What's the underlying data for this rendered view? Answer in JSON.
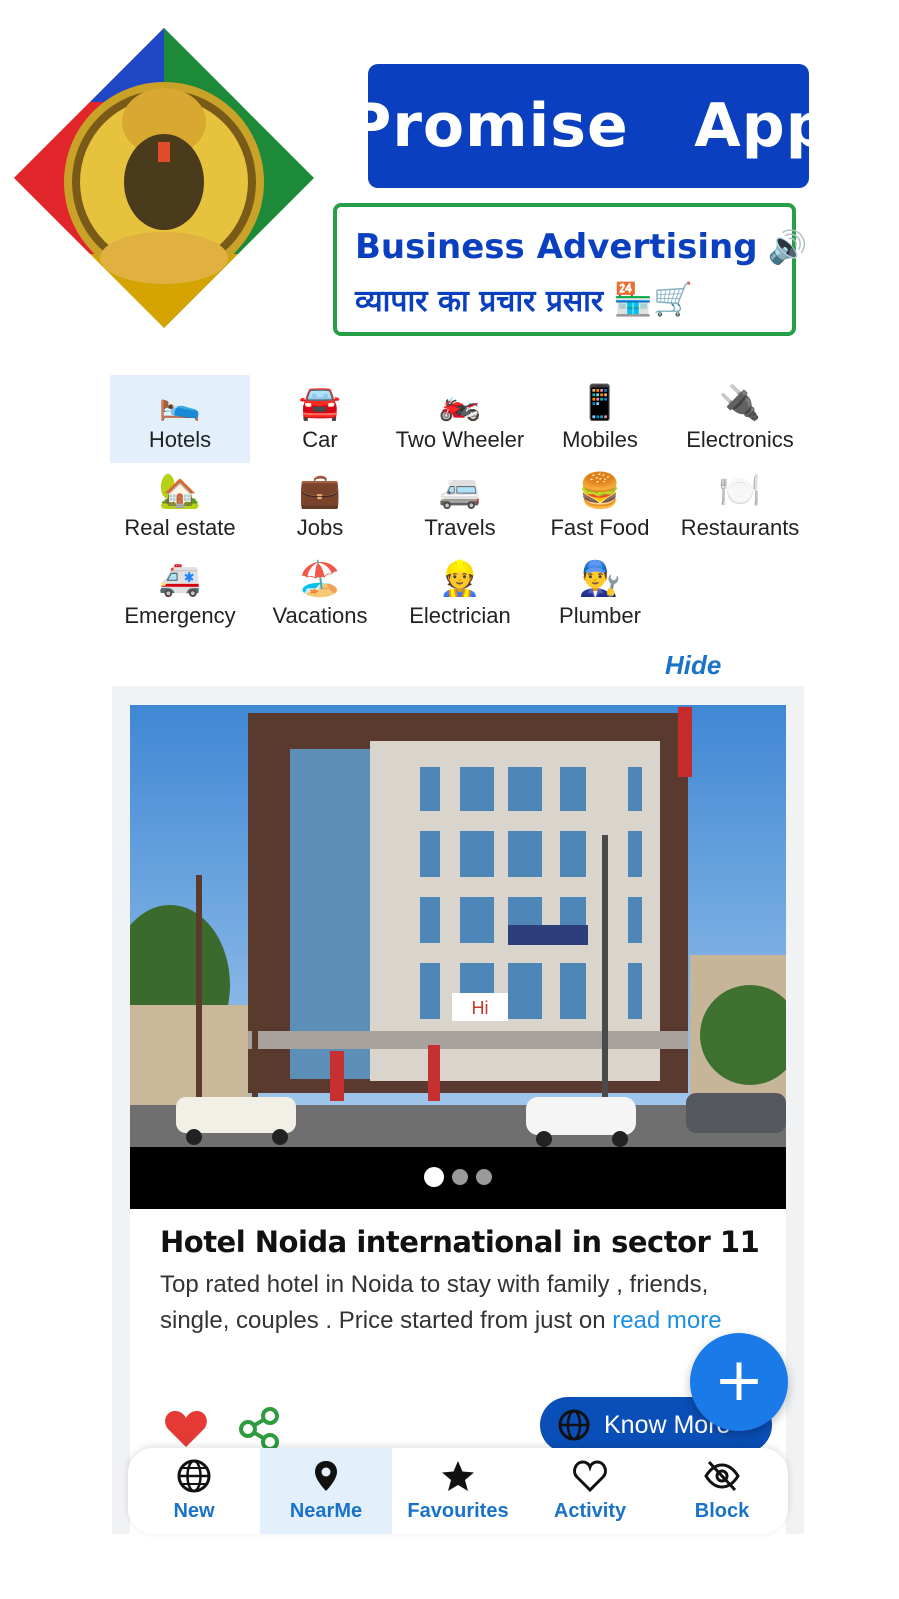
{
  "header": {
    "title": "Promise   App",
    "tagline_en": "Business Advertising",
    "tagline_en_icon": "🔊",
    "tagline_hi": "व्यापार का प्रचार प्रसार",
    "tagline_hi_icons": "🏪🛒"
  },
  "categories": [
    {
      "label": "Hotels",
      "icon": "🛌"
    },
    {
      "label": "Car",
      "icon": "🚘"
    },
    {
      "label": "Two Wheeler",
      "icon": "🏍️"
    },
    {
      "label": "Mobiles",
      "icon": "📱"
    },
    {
      "label": "Electronics",
      "icon": "🔌"
    },
    {
      "label": "Real estate",
      "icon": "🏡"
    },
    {
      "label": "Jobs",
      "icon": "💼"
    },
    {
      "label": "Travels",
      "icon": "🚐"
    },
    {
      "label": "Fast Food",
      "icon": "🍔"
    },
    {
      "label": "Restaurants",
      "icon": "🍽️"
    },
    {
      "label": "Emergency",
      "icon": "🚑"
    },
    {
      "label": "Vacations",
      "icon": "🏖️"
    },
    {
      "label": "Electrician",
      "icon": "👷"
    },
    {
      "label": "Plumber",
      "icon": "👨‍🔧"
    }
  ],
  "hide_label": "Hide",
  "listing": {
    "title": "Hotel Noida international in sector 11",
    "description": "Top rated hotel in Noida to stay with family , friends, single, couples . Price started from just on ",
    "read_more": "read more",
    "know_more": "Know More",
    "slide_count": 3,
    "active_slide": 1,
    "sign_text": "Hi"
  },
  "fab_label": "+",
  "bottom_nav": [
    {
      "label": "New",
      "icon": "globe-icon"
    },
    {
      "label": "NearMe",
      "icon": "location-pin-icon"
    },
    {
      "label": "Favourites",
      "icon": "star-icon"
    },
    {
      "label": "Activity",
      "icon": "heart-outline-icon"
    },
    {
      "label": "Block",
      "icon": "eye-off-icon"
    }
  ],
  "colors": {
    "brand_blue": "#0a3fbf",
    "tag_border": "#26a046",
    "link_blue": "#1a73c8",
    "fab_blue": "#1a7be8",
    "heart_red": "#e53935",
    "share_green": "#2e9b3e"
  }
}
